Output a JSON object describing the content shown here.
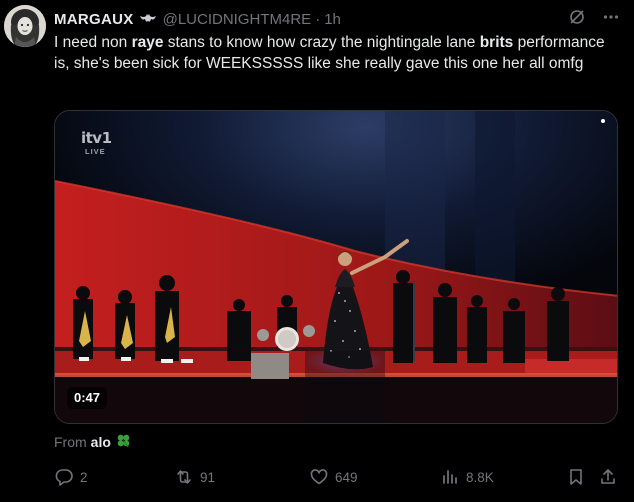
{
  "author": {
    "display_name": "MARGAUX",
    "handle": "@LUCIDNIGHTM4RE",
    "time": "1h",
    "name_emoji_icon": "bat-emoji-icon"
  },
  "tweet": {
    "text_parts": [
      {
        "text": "I need non ",
        "bold": false
      },
      {
        "text": "raye",
        "bold": true
      },
      {
        "text": " stans to know how crazy the nightingale lane ",
        "bold": false
      },
      {
        "text": "brits",
        "bold": true
      },
      {
        "text": " performance is, she's been sick for WEEKSSSSS like she really gave this one her all omfg",
        "bold": false
      }
    ]
  },
  "media": {
    "channel_logo": "itv1",
    "channel_live": "LIVE",
    "duration": "0:47"
  },
  "source": {
    "prefix": "From",
    "name": "alo",
    "icon": "four-leaf-clover-icon"
  },
  "actions": {
    "replies": "2",
    "reposts": "91",
    "likes": "649",
    "views": "8.8K"
  },
  "colors": {
    "background": "#000000",
    "text": "#e7e9ea",
    "muted": "#71767b",
    "stage_red": "#b01e1e",
    "clover_green": "#3aa13a"
  }
}
